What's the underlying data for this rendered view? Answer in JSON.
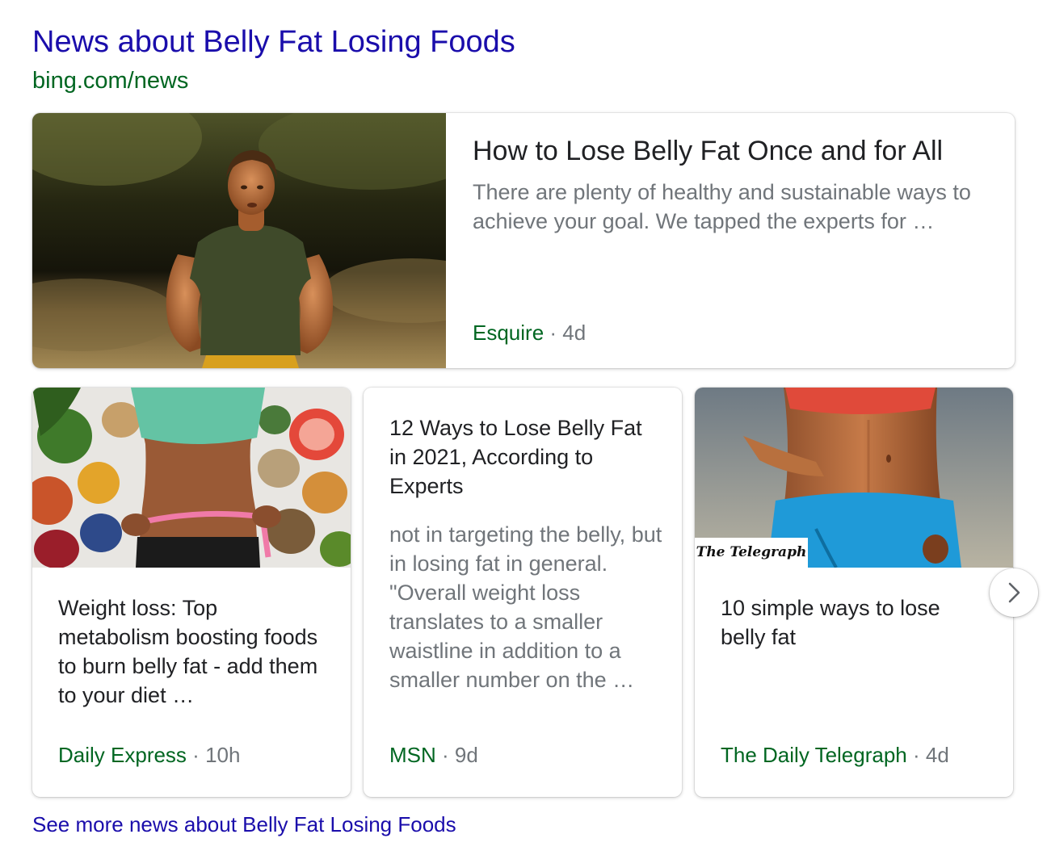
{
  "header": {
    "title": "News about Belly Fat Losing Foods",
    "source_url": "bing.com/news"
  },
  "featured": {
    "headline": "How to Lose Belly Fat Once and for All",
    "snippet": "There are plenty of healthy and sustainable ways to achieve your goal. We tapped the experts for …",
    "publisher": "Esquire",
    "separator": "·",
    "age": "4d",
    "image_icon": "man-running-photo"
  },
  "cards": [
    {
      "headline": "Weight loss: Top metabolism boosting foods to burn belly fat - add them to your diet …",
      "publisher": "Daily Express",
      "separator": "·",
      "age": "10h",
      "image_icon": "healthy-foods-waist-measure-photo"
    },
    {
      "headline": "12 Ways to Lose Belly Fat in 2021, According to Experts",
      "snippet": "not in targeting the belly, but in losing fat in general. \"Overall weight loss translates to a smaller waistline in addition to a smaller number on the …",
      "publisher": "MSN",
      "separator": "·",
      "age": "9d"
    },
    {
      "headline": "10 simple ways to lose belly fat",
      "publisher": "The Daily Telegraph",
      "separator": "·",
      "age": "4d",
      "image_icon": "toned-abs-photo",
      "image_badge": "The Telegraph"
    }
  ],
  "carousel": {
    "next_icon": "chevron-right-icon"
  },
  "footer": {
    "see_more": "See more news about Belly Fat Losing Foods"
  },
  "colors": {
    "link_blue": "#1a0dab",
    "url_green": "#006621",
    "meta_gray": "#70757a",
    "headline_dark": "#202124"
  }
}
